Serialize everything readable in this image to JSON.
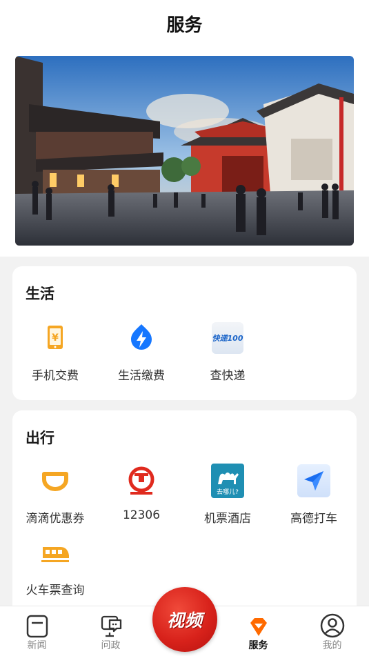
{
  "header": {
    "title": "服务"
  },
  "banner": {
    "alt": "景区"
  },
  "life": {
    "title": "生活",
    "items": [
      {
        "label": "手机交费",
        "icon": "phone-yuan-icon"
      },
      {
        "label": "生活缴费",
        "icon": "lightning-bill-icon"
      },
      {
        "label": "查快递",
        "icon": "kuaidi100-icon",
        "icon_text": "快递100"
      }
    ]
  },
  "travel": {
    "title": "出行",
    "items": [
      {
        "label": "滴滴优惠券",
        "icon": "didi-icon"
      },
      {
        "label": "12306",
        "icon": "railway-12306-icon"
      },
      {
        "label": "机票酒店",
        "icon": "qunar-camel-icon",
        "icon_text": "去哪儿?"
      },
      {
        "label": "高德打车",
        "icon": "amap-arrow-icon"
      },
      {
        "label": "火车票查询",
        "icon": "train-icon"
      }
    ]
  },
  "tabbar": {
    "tabs": [
      {
        "label": "新闻",
        "icon": "news-icon"
      },
      {
        "label": "问政",
        "icon": "chat-screen-icon"
      },
      {
        "label": "服务",
        "icon": "service-gem-icon",
        "active": true
      },
      {
        "label": "我的",
        "icon": "profile-icon"
      }
    ],
    "video_label": "视频"
  },
  "colors": {
    "accent": "#ff6a00",
    "video_red": "#d8221b",
    "orange_icon": "#f5a623",
    "blue_icon": "#1677ff"
  }
}
